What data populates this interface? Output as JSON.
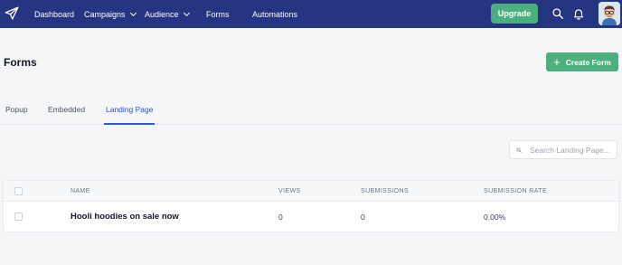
{
  "nav": {
    "items": [
      {
        "label": "Dashboard",
        "has_dropdown": false
      },
      {
        "label": "Campaigns",
        "has_dropdown": true
      },
      {
        "label": "Audience",
        "has_dropdown": true
      },
      {
        "label": "Forms",
        "has_dropdown": false
      },
      {
        "label": "Automations",
        "has_dropdown": false
      }
    ],
    "upgrade_label": "Upgrade",
    "icons": [
      "paper-plane-logo-icon",
      "search-icon",
      "bell-icon",
      "avatar"
    ]
  },
  "page": {
    "title": "Forms",
    "create_button_label": "Create Form"
  },
  "tabs": [
    {
      "label": "Popup",
      "active": false
    },
    {
      "label": "Embedded",
      "active": false
    },
    {
      "label": "Landing Page",
      "active": true
    }
  ],
  "search": {
    "placeholder": "Search Landing Page...",
    "value": ""
  },
  "table": {
    "columns": [
      "NAME",
      "VIEWS",
      "SUBMISSIONS",
      "SUBMISSION RATE"
    ],
    "rows": [
      {
        "name": "Hooli hoodies on sale now",
        "views": "0",
        "submissions": "0",
        "submission_rate": "0.00%"
      }
    ]
  },
  "colors": {
    "nav_bg": "#263582",
    "accent_green": "#4caf7d",
    "active_tab": "#3056c9",
    "page_bg": "#f5f6f8"
  }
}
